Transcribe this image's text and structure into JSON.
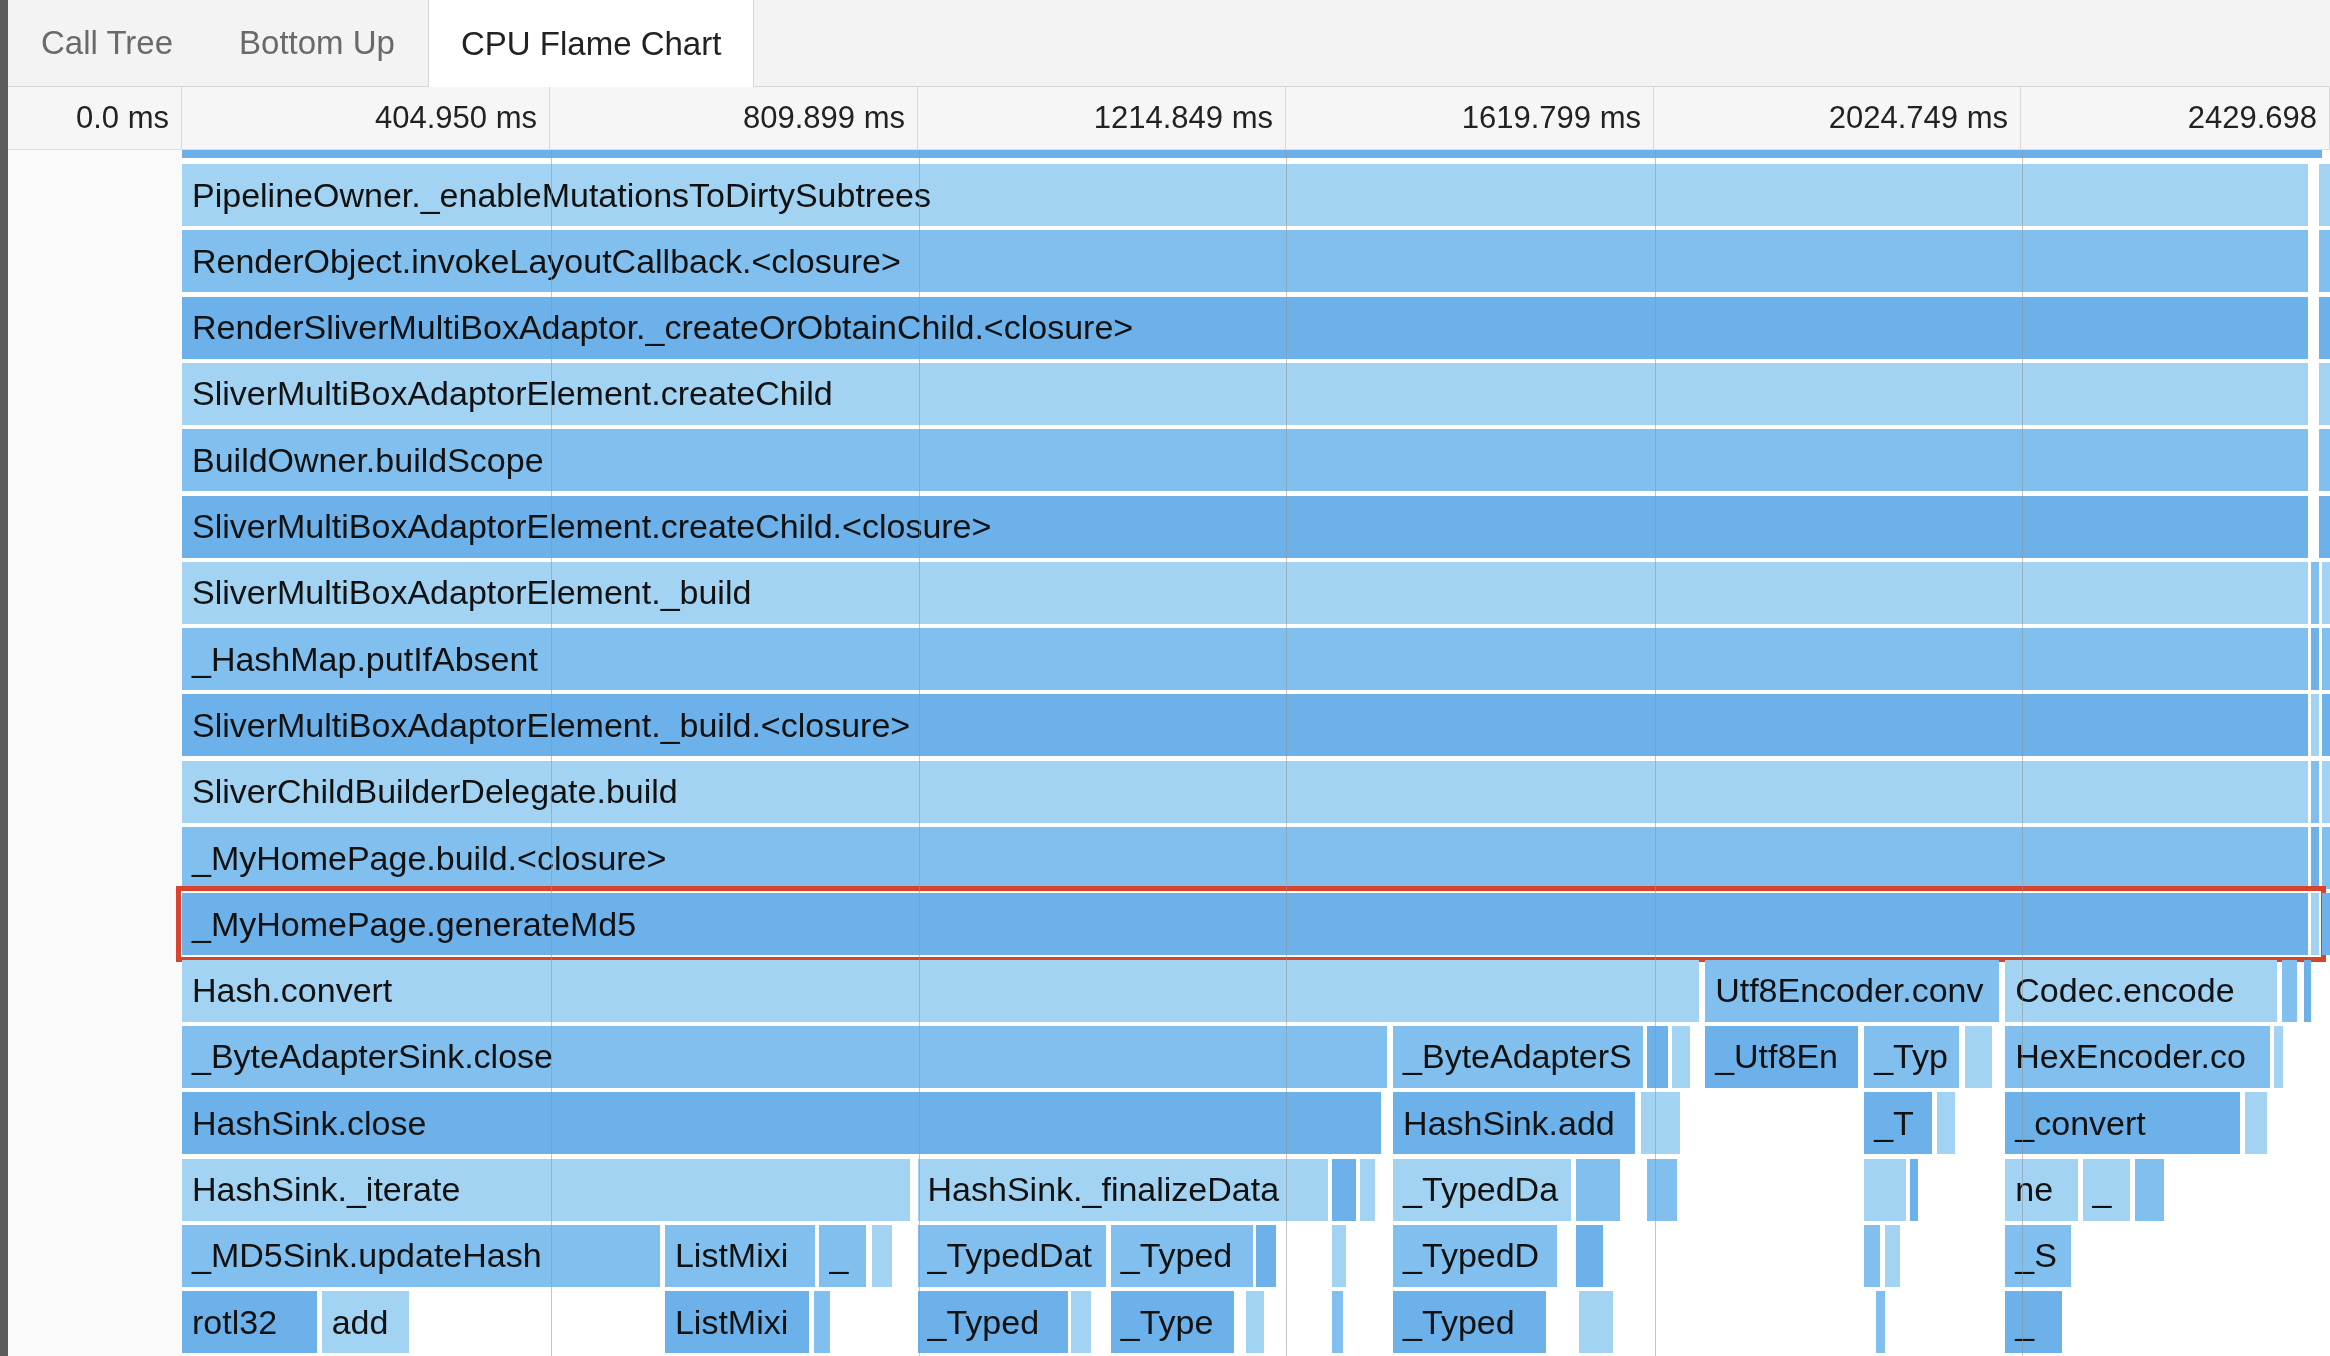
{
  "tabs": [
    {
      "label": "Call Tree",
      "selected": false
    },
    {
      "label": "Bottom Up",
      "selected": false
    },
    {
      "label": "CPU Flame Chart",
      "selected": true
    }
  ],
  "ruler": {
    "ticks": [
      "0.0 ms",
      "404.950 ms",
      "809.899 ms",
      "1214.849 ms",
      "1619.799 ms",
      "2024.749 ms",
      "2429.698"
    ]
  },
  "rows": [
    {
      "frames": [
        {
          "label": "PipelineOwner._enableMutationsToDirtySubtrees",
          "highlighted": false
        }
      ]
    },
    {
      "frames": [
        {
          "label": "RenderObject.invokeLayoutCallback.<closure>",
          "highlighted": false
        }
      ]
    },
    {
      "frames": [
        {
          "label": "RenderSliverMultiBoxAdaptor._createOrObtainChild.<closure>",
          "highlighted": false
        }
      ]
    },
    {
      "frames": [
        {
          "label": "SliverMultiBoxAdaptorElement.createChild",
          "highlighted": false
        }
      ]
    },
    {
      "frames": [
        {
          "label": "BuildOwner.buildScope",
          "highlighted": false
        }
      ]
    },
    {
      "frames": [
        {
          "label": "SliverMultiBoxAdaptorElement.createChild.<closure>",
          "highlighted": false
        }
      ]
    },
    {
      "frames": [
        {
          "label": "SliverMultiBoxAdaptorElement._build",
          "highlighted": false
        }
      ]
    },
    {
      "frames": [
        {
          "label": "_HashMap.putIfAbsent",
          "highlighted": false
        }
      ]
    },
    {
      "frames": [
        {
          "label": "SliverMultiBoxAdaptorElement._build.<closure>",
          "highlighted": false
        }
      ]
    },
    {
      "frames": [
        {
          "label": "SliverChildBuilderDelegate.build",
          "highlighted": false
        }
      ]
    },
    {
      "frames": [
        {
          "label": "_MyHomePage.build.<closure>",
          "highlighted": false
        }
      ]
    },
    {
      "frames": [
        {
          "label": "_MyHomePage.generateMd5",
          "highlighted": true
        }
      ]
    },
    {
      "frames": [
        {
          "label": "Hash.convert",
          "highlighted": false
        },
        {
          "label": "Utf8Encoder.conv",
          "highlighted": false
        },
        {
          "label": "Codec.encode",
          "highlighted": false
        }
      ]
    },
    {
      "frames": [
        {
          "label": "_ByteAdapterSink.close",
          "highlighted": false
        },
        {
          "label": "_ByteAdapterS",
          "highlighted": false
        },
        {
          "label": "_Utf8En",
          "highlighted": false
        },
        {
          "label": "_Typ",
          "highlighted": false
        },
        {
          "label": "HexEncoder.co",
          "highlighted": false
        }
      ]
    },
    {
      "frames": [
        {
          "label": "HashSink.close",
          "highlighted": false
        },
        {
          "label": "HashSink.add",
          "highlighted": false
        },
        {
          "label": "_T",
          "highlighted": false
        },
        {
          "label": "_convert",
          "highlighted": false
        }
      ]
    },
    {
      "frames": [
        {
          "label": "HashSink._iterate",
          "highlighted": false
        },
        {
          "label": "HashSink._finalizeData",
          "highlighted": false
        },
        {
          "label": "_TypedDa",
          "highlighted": false
        },
        {
          "label": "ne",
          "highlighted": false
        },
        {
          "label": "_",
          "highlighted": false
        }
      ]
    },
    {
      "frames": [
        {
          "label": "_MD5Sink.updateHash",
          "highlighted": false
        },
        {
          "label": "ListMixi",
          "highlighted": false
        },
        {
          "label": "_",
          "highlighted": false
        },
        {
          "label": "_TypedDat",
          "highlighted": false
        },
        {
          "label": "_Typed",
          "highlighted": false
        },
        {
          "label": "_TypedD",
          "highlighted": false
        },
        {
          "label": "_S",
          "highlighted": false
        }
      ]
    },
    {
      "frames": [
        {
          "label": "rotl32",
          "highlighted": false
        },
        {
          "label": "add",
          "highlighted": false
        },
        {
          "label": "ListMixi",
          "highlighted": false
        },
        {
          "label": "_Typed",
          "highlighted": false
        },
        {
          "label": "_Type",
          "highlighted": false
        },
        {
          "label": "_Typed",
          "highlighted": false
        },
        {
          "label": "_",
          "highlighted": false
        }
      ]
    }
  ]
}
